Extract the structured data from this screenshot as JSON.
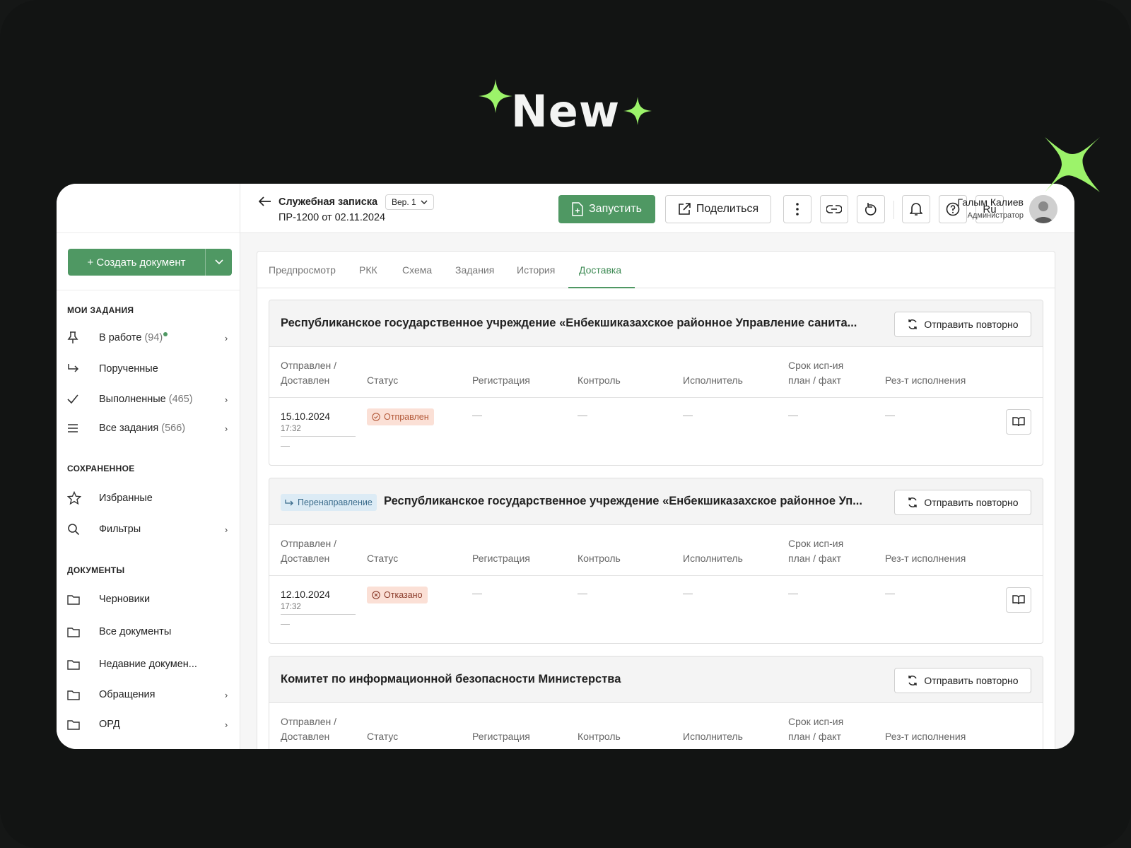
{
  "hero": {
    "title": "New"
  },
  "sidebar": {
    "create_label": "+ Создать документ",
    "sections": {
      "tasks": "МОИ ЗАДАНИЯ",
      "saved": "СОХРАНЕННОЕ",
      "documents": "ДОКУМЕНТЫ"
    },
    "items": [
      {
        "label": "В работе",
        "count": "(94)"
      },
      {
        "label": "Порученные",
        "count": ""
      },
      {
        "label": "Выполненные",
        "count": "(465)"
      },
      {
        "label": "Все задания",
        "count": "(566)"
      },
      {
        "label": "Избранные",
        "count": ""
      },
      {
        "label": "Фильтры",
        "count": ""
      },
      {
        "label": "Черновики",
        "count": ""
      },
      {
        "label": "Все документы",
        "count": ""
      },
      {
        "label": "Недавние докумен...",
        "count": ""
      },
      {
        "label": "Обращения",
        "count": ""
      },
      {
        "label": "ОРД",
        "count": ""
      }
    ]
  },
  "topbar": {
    "doc_title": "Служебная записка",
    "version": "Вер. 1",
    "doc_subtitle": "ПР-1200 от 02.11.2024",
    "run_label": "Запустить",
    "share_label": "Поделиться",
    "lang": "Ru",
    "user_name": "Галым Калиев",
    "user_role": "Администратор"
  },
  "tabs": [
    "Предпросмотр",
    "РКК",
    "Схема",
    "Задания",
    "История",
    "Доставка"
  ],
  "columns": {
    "sent": [
      "Отправлен /",
      "Доставлен"
    ],
    "status": "Статус",
    "registration": "Регистрация",
    "control": "Контроль",
    "executor": "Исполнитель",
    "deadline": [
      "Срок исп-ия",
      "план / факт"
    ],
    "result": "Рез-т исполнения"
  },
  "resend_label": "Отправить повторно",
  "deliveries": [
    {
      "title": "Республиканское государственное учреждение «Енбекшиказахское районное Управление санита...",
      "tag": "",
      "date": "15.10.2024",
      "time": "17:32",
      "delivered": "—",
      "status": "Отправлен",
      "dash": "—"
    },
    {
      "title": "Республиканское государственное учреждение «Енбекшиказахское районное Уп...",
      "tag": "Перенаправление",
      "date": "12.10.2024",
      "time": "17:32",
      "delivered": "—",
      "status": "Отказано",
      "dash": "—"
    },
    {
      "title": "Комитет по информационной безопасности Министерства",
      "tag": ""
    }
  ],
  "colors": {
    "accent": "#4f9863",
    "spark": "#9cf36a",
    "background": "#121413"
  }
}
